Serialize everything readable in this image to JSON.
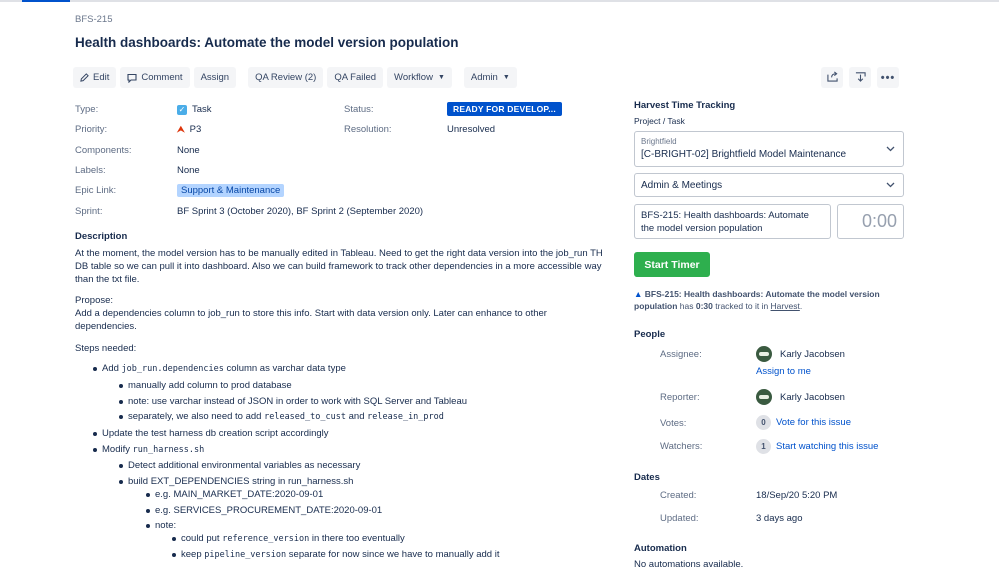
{
  "issue": {
    "key": "BFS-215",
    "title": "Health dashboards: Automate the model version population"
  },
  "toolbar": {
    "edit": "Edit",
    "comment": "Comment",
    "assign": "Assign",
    "qa_review": "QA Review (2)",
    "qa_failed": "QA Failed",
    "workflow": "Workflow",
    "admin": "Admin"
  },
  "fields": {
    "type_label": "Type:",
    "type_value": "Task",
    "priority_label": "Priority:",
    "priority_value": "P3",
    "components_label": "Components:",
    "components_value": "None",
    "labels_label": "Labels:",
    "labels_value": "None",
    "epic_label": "Epic Link:",
    "epic_value": "Support & Maintenance",
    "sprint_label": "Sprint:",
    "sprint_value": "BF Sprint 3 (October 2020), BF Sprint 2 (September 2020)",
    "status_label": "Status:",
    "status_value": "READY FOR DEVELOP...",
    "resolution_label": "Resolution:",
    "resolution_value": "Unresolved"
  },
  "description": {
    "heading": "Description",
    "para1": "At the moment, the model version has to be manually edited in Tableau. Need to get the right data version into the job_run TH DB table so we can pull it into dashboard. Also we can build framework to track other dependencies in a more accessible way than the txt file.",
    "propose_label": "Propose:",
    "propose_text": "Add a dependencies column to job_run to store this info. Start with data version only. Later can enhance to other dependencies.",
    "steps_label": "Steps needed:",
    "b1_pre": "Add ",
    "b1_code": "job_run.dependencies",
    "b1_post": " column as varchar data type",
    "b1a": "manually add column to prod database",
    "b1b": "note: use varchar instead of JSON in order to work with SQL Server and Tableau",
    "b1c_pre": "separately, we also need to add ",
    "b1c_code1": "released_to_cust",
    "b1c_mid": " and ",
    "b1c_code2": "release_in_prod",
    "b2": "Update the test harness db creation script accordingly",
    "b3_pre": "Modify ",
    "b3_code": "run_harness.sh",
    "b3a": "Detect additional environmental variables as necessary",
    "b3b": "build EXT_DEPENDENCIES string in run_harness.sh",
    "b3b1": "e.g. MAIN_MARKET_DATE:2020-09-01",
    "b3b2": "e.g. SERVICES_PROCUREMENT_DATE:2020-09-01",
    "b3b3": "note:",
    "b3b3a_pre": "could put ",
    "b3b3a_code": "reference_version",
    "b3b3a_post": " in there too eventually",
    "b3b3b_pre": "keep ",
    "b3b3b_code": "pipeline_version",
    "b3b3b_post": " separate for now since we have to manually add it"
  },
  "harvest": {
    "heading": "Harvest Time Tracking",
    "project_task_label": "Project / Task",
    "client": "Brightfield",
    "project": "[C-BRIGHT-02] Brightfield Model Maintenance",
    "task": "Admin & Meetings",
    "notes": "BFS-215: Health dashboards: Automate the model version population",
    "time": "0:00",
    "start_button": "Start Timer",
    "tracked_issue": "BFS-215: Health dashboards: Automate the model version population",
    "tracked_has": " has ",
    "tracked_time": "0:30",
    "tracked_mid": " tracked to it in ",
    "tracked_link": "Harvest",
    "tracked_end": "."
  },
  "people": {
    "heading": "People",
    "assignee_label": "Assignee:",
    "assignee_name": "Karly Jacobsen",
    "assign_to_me": "Assign to me",
    "reporter_label": "Reporter:",
    "reporter_name": "Karly Jacobsen",
    "votes_label": "Votes:",
    "votes_count": "0",
    "vote_link": "Vote for this issue",
    "watchers_label": "Watchers:",
    "watchers_count": "1",
    "watch_link": "Start watching this issue"
  },
  "dates": {
    "heading": "Dates",
    "created_label": "Created:",
    "created_value": "18/Sep/20 5:20 PM",
    "updated_label": "Updated:",
    "updated_value": "3 days ago"
  },
  "automation": {
    "heading": "Automation",
    "text": "No automations available."
  },
  "colors": {
    "status_blue": "#0052cc",
    "start_green": "#2eaf4e",
    "link_blue": "#0052cc"
  }
}
